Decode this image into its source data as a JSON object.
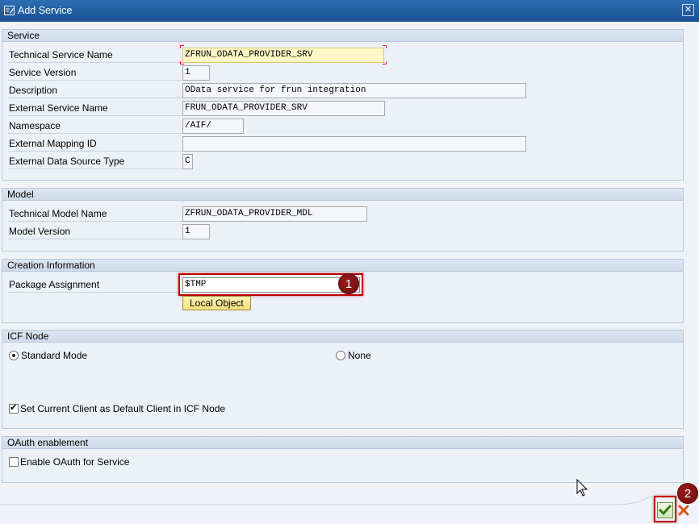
{
  "window": {
    "title": "Add Service",
    "close_glyph": "✕"
  },
  "service": {
    "heading": "Service",
    "fields": [
      {
        "label": "Technical Service Name",
        "value": "ZFRUN_ODATA_PROVIDER_SRV"
      },
      {
        "label": "Service Version",
        "value": "1"
      },
      {
        "label": "Description",
        "value": "OData service for frun integration"
      },
      {
        "label": "External Service Name",
        "value": "FRUN_ODATA_PROVIDER_SRV"
      },
      {
        "label": "Namespace",
        "value": "/AIF/"
      },
      {
        "label": "External Mapping ID",
        "value": ""
      },
      {
        "label": "External Data Source Type",
        "value": "C"
      }
    ]
  },
  "model": {
    "heading": "Model",
    "fields": [
      {
        "label": "Technical Model Name",
        "value": "ZFRUN_ODATA_PROVIDER_MDL"
      },
      {
        "label": "Model Version",
        "value": "1"
      }
    ]
  },
  "creation": {
    "heading": "Creation Information",
    "package_label": "Package Assignment",
    "package_value": "$TMP",
    "local_object_button": "Local Object"
  },
  "icf": {
    "heading": "ICF Node",
    "radio_standard": "Standard Mode",
    "radio_standard_selected": true,
    "radio_none": "None",
    "checkbox_client": "Set Current Client as Default Client in ICF Node",
    "checkbox_client_checked": true
  },
  "oauth": {
    "heading": "OAuth enablement",
    "checkbox_enable": "Enable OAuth for Service",
    "checkbox_enable_checked": false
  },
  "annotations": {
    "badge1": "1",
    "badge2": "2"
  },
  "icons": {
    "window": "window-form-icon",
    "confirm": "checkmark-icon",
    "cancel": "cancel-x-icon",
    "cursor": "mouse-pointer-icon"
  },
  "colors": {
    "titlebar": "#1a4f91",
    "highlight": "#c00000",
    "badge": "#7a1010",
    "focused_field": "#fff7c6",
    "local_object": "#f6de7a"
  }
}
